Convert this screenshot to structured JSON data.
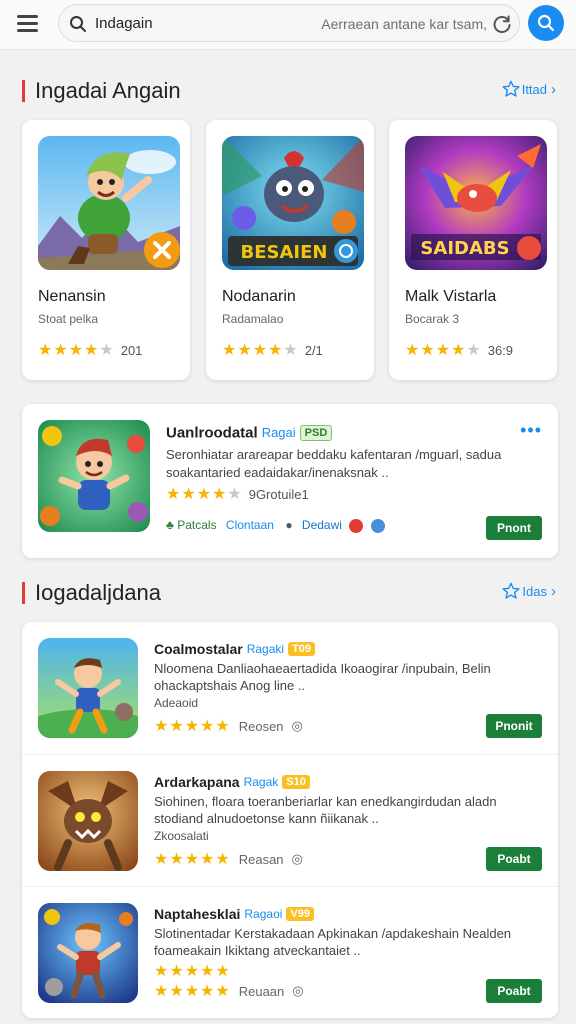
{
  "search": {
    "value": "Indagain",
    "hint": "Aerraean antane kar tsam,"
  },
  "section1": {
    "title": "Ingadai Angain",
    "more": "Ittad"
  },
  "top_cards": [
    {
      "name": "Nenansin",
      "sub": "Stoat pelka",
      "rating_value": 4,
      "rating_text": "201"
    },
    {
      "name": "Nodanarin",
      "sub": "Radamalao",
      "rating_value": 3.5,
      "rating_text": "2/1",
      "art_text": "BESAIEN"
    },
    {
      "name": "Malk Vistarla",
      "sub": "Bocarak 3",
      "rating_value": 3.5,
      "rating_text": "36:9",
      "art_text": "SAIDABS"
    }
  ],
  "featured": {
    "name": "Uanlroodatal",
    "category": "Ragai",
    "badge": "PSD",
    "desc": "Seronhiatar arareapar beddaku kafentaran /mguarl, sadua soakantaried eadaidakar/inenaksnak ..",
    "rating_value": 4,
    "rating_text": "9Grotuile1",
    "meta1": "Patcals",
    "meta2": "Clontaan",
    "meta3": "Dedawi",
    "button": "Pnont"
  },
  "section2": {
    "title": "Iogadaljdana",
    "more": "Idas"
  },
  "list": [
    {
      "name": "Coalmostalar",
      "category": "Ragaki",
      "badge": "T09",
      "desc": "Nloomena Danliaohaeaertadida Ikoaogirar /inpubain, Belin ohackaptshais Anog line ..",
      "extra": "Adeaoid",
      "rating_value": 4.5,
      "rating_text": "Reosen",
      "button": "Pnonit"
    },
    {
      "name": "Ardarkapana",
      "category": "Ragak",
      "badge": "S10",
      "desc": "Siohinen, floara toeranberiarlar kan enedkangirdudan aladn stodiand alnudoetonse kann ñiikanak ..",
      "extra": "Zkoosalati",
      "rating_value": 4.5,
      "rating_text": "Reasan",
      "button": "Poabt"
    },
    {
      "name": "Naptahesklai",
      "category": "Ragaoi",
      "badge": "V99",
      "desc": "Slotinentadar Kerstakadaan Apkinakan /apdakeshain Nealden foameakain Ikiktang atveckantaiet ..",
      "extra": "",
      "rating_value": 4.5,
      "rating_text": "Reuaan",
      "button": "Poabt"
    }
  ],
  "colors": {
    "accent": "#1a8bf0",
    "section_marker": "#e53935",
    "button_green": "#1b7f3a",
    "star": "#f4b400"
  },
  "icons": {
    "menu": "menu-icon",
    "search": "search-icon",
    "refresh": "refresh-icon",
    "more": "star-outline-icon"
  }
}
